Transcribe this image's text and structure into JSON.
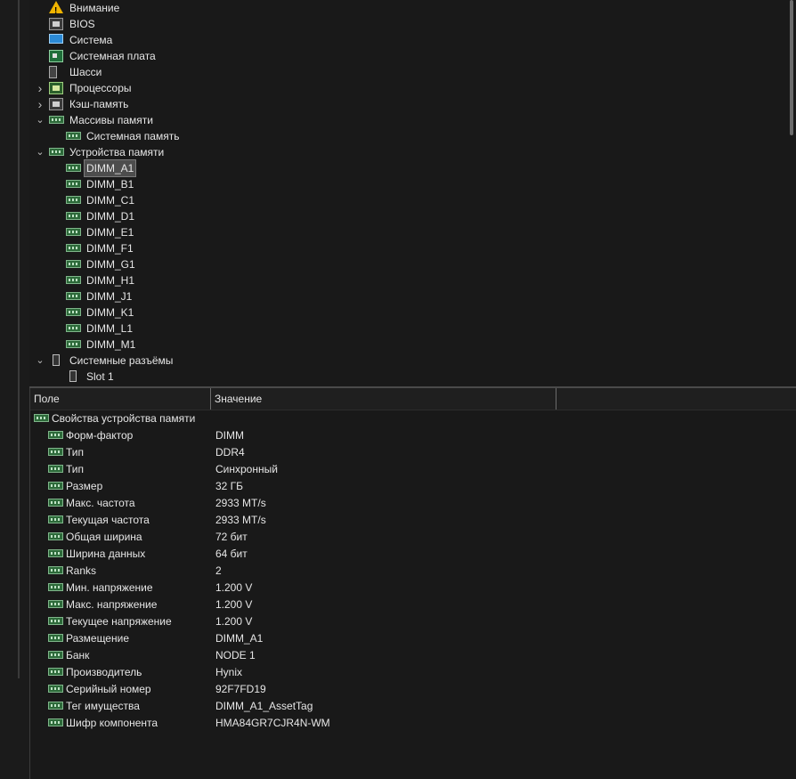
{
  "tree": {
    "items": [
      {
        "label": "Внимание",
        "icon": "warning-icon",
        "expander": ""
      },
      {
        "label": "BIOS",
        "icon": "bios-chip-icon",
        "expander": ""
      },
      {
        "label": "Система",
        "icon": "monitor-icon",
        "expander": ""
      },
      {
        "label": "Системная плата",
        "icon": "motherboard-icon",
        "expander": ""
      },
      {
        "label": "Шасси",
        "icon": "chassis-icon",
        "expander": ""
      },
      {
        "label": "Процессоры",
        "icon": "cpu-icon",
        "expander": "›"
      },
      {
        "label": "Кэш-память",
        "icon": "cache-chip-icon",
        "expander": "›"
      },
      {
        "label": "Массивы памяти",
        "icon": "memory-array-icon",
        "expander": "⌄"
      },
      {
        "label": "Системная память",
        "icon": "memory-module-icon",
        "expander": ""
      },
      {
        "label": "Устройства памяти",
        "icon": "memory-devices-icon",
        "expander": "⌄"
      },
      {
        "label": "DIMM_A1",
        "icon": "memory-module-icon",
        "expander": "",
        "selected": true
      },
      {
        "label": "DIMM_B1",
        "icon": "memory-module-icon",
        "expander": ""
      },
      {
        "label": "DIMM_C1",
        "icon": "memory-module-icon",
        "expander": ""
      },
      {
        "label": "DIMM_D1",
        "icon": "memory-module-icon",
        "expander": ""
      },
      {
        "label": "DIMM_E1",
        "icon": "memory-module-icon",
        "expander": ""
      },
      {
        "label": "DIMM_F1",
        "icon": "memory-module-icon",
        "expander": ""
      },
      {
        "label": "DIMM_G1",
        "icon": "memory-module-icon",
        "expander": ""
      },
      {
        "label": "DIMM_H1",
        "icon": "memory-module-icon",
        "expander": ""
      },
      {
        "label": "DIMM_J1",
        "icon": "memory-module-icon",
        "expander": ""
      },
      {
        "label": "DIMM_K1",
        "icon": "memory-module-icon",
        "expander": ""
      },
      {
        "label": "DIMM_L1",
        "icon": "memory-module-icon",
        "expander": ""
      },
      {
        "label": "DIMM_M1",
        "icon": "memory-module-icon",
        "expander": ""
      },
      {
        "label": "Системные разъёмы",
        "icon": "system-slots-icon",
        "expander": "⌄"
      },
      {
        "label": "Slot 1",
        "icon": "slot-icon",
        "expander": ""
      }
    ]
  },
  "grid": {
    "col_field": "Поле",
    "col_value": "Значение",
    "group_title": "Свойства устройства памяти",
    "rows": [
      {
        "name": "Форм-фактор",
        "value": "DIMM"
      },
      {
        "name": "Тип",
        "value": "DDR4"
      },
      {
        "name": "Тип",
        "value": "Синхронный"
      },
      {
        "name": "Размер",
        "value": "32 ГБ"
      },
      {
        "name": "Макс. частота",
        "value": "2933 MT/s"
      },
      {
        "name": "Текущая частота",
        "value": "2933 MT/s"
      },
      {
        "name": "Общая ширина",
        "value": "72 бит"
      },
      {
        "name": "Ширина данных",
        "value": "64 бит"
      },
      {
        "name": "Ranks",
        "value": "2"
      },
      {
        "name": "Мин. напряжение",
        "value": "1.200 V"
      },
      {
        "name": "Макс. напряжение",
        "value": "1.200 V"
      },
      {
        "name": "Текущее напряжение",
        "value": "1.200 V"
      },
      {
        "name": "Размещение",
        "value": "DIMM_A1"
      },
      {
        "name": "Банк",
        "value": "NODE 1"
      },
      {
        "name": "Производитель",
        "value": "Hynix"
      },
      {
        "name": "Серийный номер",
        "value": "92F7FD19"
      },
      {
        "name": "Тег имущества",
        "value": "DIMM_A1_AssetTag"
      },
      {
        "name": "Шифр компонента",
        "value": "HMA84GR7CJR4N-WM"
      }
    ]
  }
}
